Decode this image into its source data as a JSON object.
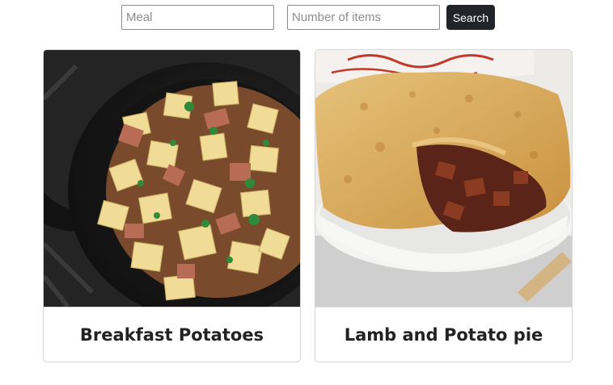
{
  "search": {
    "meal_placeholder": "Meal",
    "count_placeholder": "Number of items",
    "button_label": "Search"
  },
  "cards": [
    {
      "title": "Breakfast Potatoes",
      "image": "skillet-potatoes-photo"
    },
    {
      "title": "Lamb and Potato pie",
      "image": "pie-photo"
    }
  ]
}
